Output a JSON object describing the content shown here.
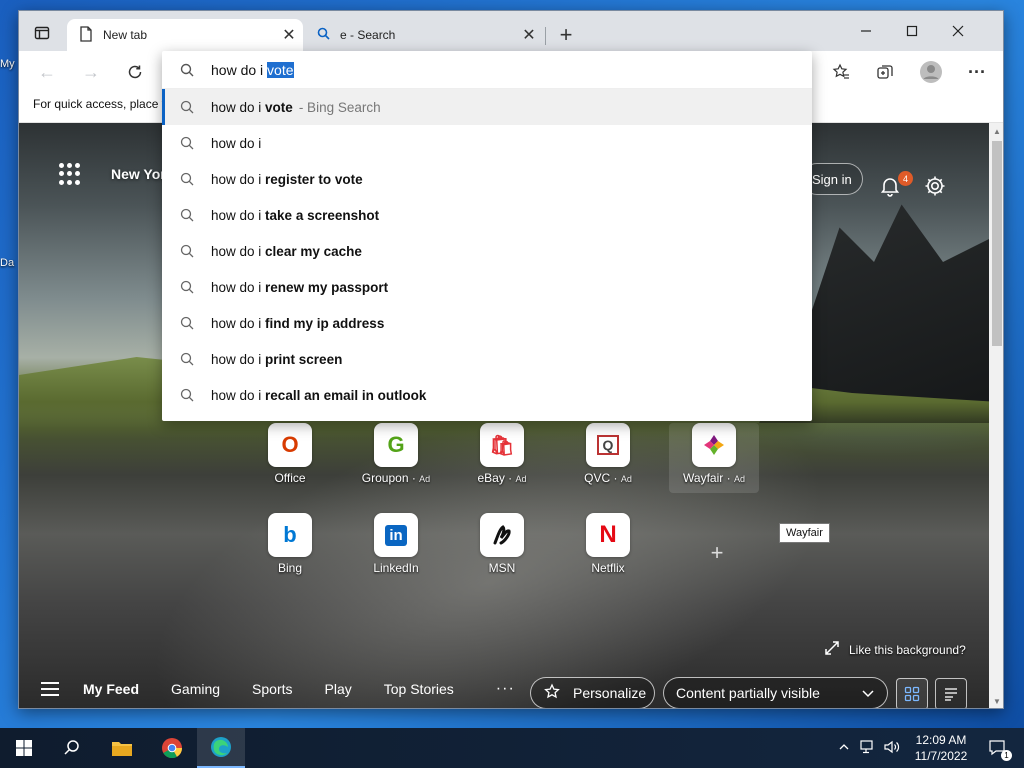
{
  "desktop": {
    "left_label_1": "My",
    "left_label_2": "Da"
  },
  "tabs": [
    {
      "label": "New tab"
    },
    {
      "label": "e - Search"
    }
  ],
  "favorites_bar": {
    "text": "For quick access, place y"
  },
  "omnibox": {
    "typed": "how do i ",
    "autocomplete": "vote",
    "suggestions": [
      {
        "prefix": "how do i ",
        "bold": "vote",
        "engine": "- Bing Search"
      },
      {
        "prefix": "how do i",
        "bold": "",
        "engine": ""
      },
      {
        "prefix": "how do i ",
        "bold": "register to vote",
        "engine": ""
      },
      {
        "prefix": "how do i ",
        "bold": "take a screenshot",
        "engine": ""
      },
      {
        "prefix": "how do i ",
        "bold": "clear my cache",
        "engine": ""
      },
      {
        "prefix": "how do i ",
        "bold": "renew my passport",
        "engine": ""
      },
      {
        "prefix": "how do i ",
        "bold": "find my ip address",
        "engine": ""
      },
      {
        "prefix": "how do i ",
        "bold": "print screen",
        "engine": ""
      },
      {
        "prefix": "how do i ",
        "bold": "recall an email in outlook",
        "engine": ""
      }
    ]
  },
  "ntp": {
    "weather": "New York",
    "signin": "Sign in",
    "notif_count": "4",
    "tiles_row1": [
      {
        "label": "Office",
        "ad": "",
        "glyph": "O",
        "color": "#d83b01"
      },
      {
        "label": "Groupon",
        "ad": "Ad",
        "glyph": "G",
        "color": "#53a318"
      },
      {
        "label": "eBay",
        "ad": "Ad",
        "glyph": "🛍",
        "color": "#e53238"
      },
      {
        "label": "QVC",
        "ad": "Ad",
        "glyph": "Q",
        "color": "#444"
      },
      {
        "label": "Wayfair",
        "ad": "Ad",
        "glyph": "✦",
        "color": "#7f187f"
      }
    ],
    "tiles_row2": [
      {
        "label": "Bing",
        "glyph": "b",
        "color": "#0078d4"
      },
      {
        "label": "LinkedIn",
        "glyph": "in",
        "color": "#0a66c2"
      },
      {
        "label": "MSN",
        "glyph": "✗",
        "color": "#111"
      },
      {
        "label": "Netflix",
        "glyph": "N",
        "color": "#e50914"
      }
    ],
    "tooltip": "Wayfair",
    "like_background": "Like this background?",
    "feed": {
      "items": [
        "My Feed",
        "Gaming",
        "Sports",
        "Play",
        "Top Stories"
      ],
      "more": "···",
      "personalize": "Personalize",
      "visibility": "Content partially visible"
    }
  },
  "taskbar": {
    "time": "12:09 AM",
    "date": "11/7/2022",
    "notifications": "1"
  }
}
